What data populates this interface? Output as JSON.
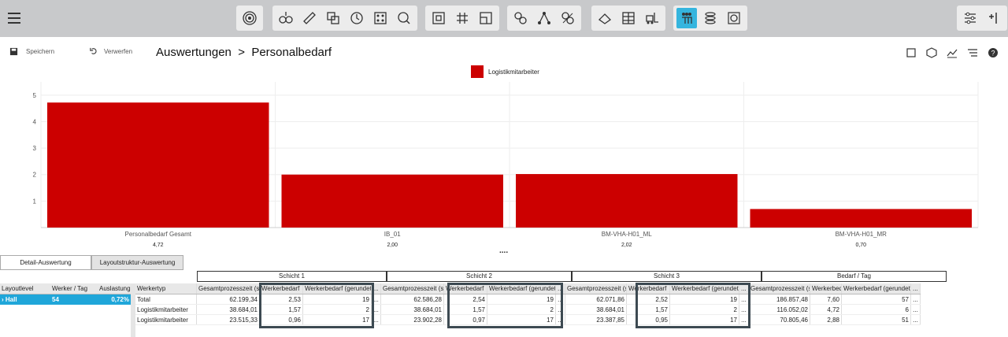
{
  "toolbar": {
    "groups": [
      [
        "radar-icon"
      ],
      [
        "process-icon",
        "ruler-icon",
        "shapes-icon",
        "clock-icon",
        "grid-dots-icon",
        "search-refresh-icon"
      ],
      [
        "frame-icon",
        "hash-icon",
        "layout-icon"
      ],
      [
        "link-icon",
        "network-icon",
        "link-alt-icon"
      ],
      [
        "conveyor-icon",
        "shelf-icon",
        "forklift-icon"
      ],
      [
        "people-icon",
        "coins-icon",
        "cycle-icon"
      ],
      [
        "settings-sliders-icon",
        "column-adjust-icon"
      ]
    ],
    "active": "people-icon"
  },
  "header": {
    "save_label": "Speichern",
    "revert_label": "Verwerfen",
    "breadcrumb": "Auswertungen  >  Personalbedarf"
  },
  "chart_data": {
    "type": "bar",
    "categories": [
      "Personalbedarf Gesamt",
      "IB_01",
      "BM-VHA-H01_ML",
      "BM-VHA-H01_MR"
    ],
    "series": [
      {
        "name": "Logistikmitarbeiter",
        "values": [
          4.72,
          2.0,
          2.02,
          0.7
        ],
        "color": "#cc0000"
      }
    ],
    "value_labels": [
      "4,72",
      "2,00",
      "2,02",
      "0,70"
    ],
    "yticks": [
      "1",
      "2",
      "3",
      "4",
      "5"
    ],
    "ylim": [
      0,
      5.5
    ],
    "legend": "top-center",
    "grid": true
  },
  "more_indicator": "....",
  "tabs": [
    "Detail-Auswertung",
    "Layoutstruktur-Auswertung"
  ],
  "left_table": {
    "headers": [
      "Layoutlevel",
      "Werker / Tag",
      "Auslastung"
    ],
    "row": [
      "Hall",
      "54",
      "0,72%"
    ]
  },
  "groups": [
    "Schicht 1",
    "Schicht 2",
    "Schicht 3",
    "Bedarf / Tag"
  ],
  "main_table": {
    "headers": [
      "Werkertyp",
      "Gesamtprozesszeit (s)",
      "Werkerbedarf",
      "Werkerbedarf (gerundet)",
      "...",
      "Gesamtprozesszeit (s)",
      "Werkerbedarf",
      "Werkerbedarf (gerundet)",
      "...",
      "Gesamtprozesszeit (s)",
      "Werkerbedarf",
      "Werkerbedarf (gerundet)",
      "...",
      "Gesamtprozesszeit (s)",
      "Werkerbedarf",
      "Werkerbedarf (gerundet)",
      "..."
    ],
    "rows": [
      [
        "Total",
        "62.199,34",
        "2,53",
        "19",
        "...",
        "62.586,28",
        "2,54",
        "19",
        "...",
        "62.071,86",
        "2,52",
        "19",
        "...",
        "186.857,48",
        "7,60",
        "57",
        "..."
      ],
      [
        "Logistikmitarbeiter",
        "38.684,01",
        "1,57",
        "2",
        "...",
        "38.684,01",
        "1,57",
        "2",
        "...",
        "38.684,01",
        "1,57",
        "2",
        "...",
        "116.052,02",
        "4,72",
        "6",
        "..."
      ],
      [
        "Logistikmitarbeiter",
        "23.515,33",
        "0,96",
        "17",
        "...",
        "23.902,28",
        "0,97",
        "17",
        "...",
        "23.387,85",
        "0,95",
        "17",
        "...",
        "70.805,46",
        "2,88",
        "51",
        "..."
      ]
    ]
  }
}
